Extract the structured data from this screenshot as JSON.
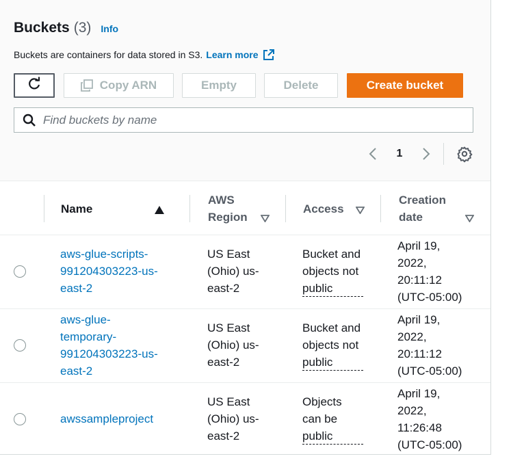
{
  "header": {
    "title": "Buckets",
    "count": "(3)",
    "info": "Info",
    "description": "Buckets are containers for data stored in S3.",
    "learn_more": "Learn more"
  },
  "toolbar": {
    "copy_arn": "Copy ARN",
    "empty": "Empty",
    "delete": "Delete",
    "create": "Create bucket"
  },
  "search": {
    "placeholder": "Find buckets by name"
  },
  "pagination": {
    "page": "1"
  },
  "table": {
    "columns": {
      "name": "Name",
      "region_line1": "AWS",
      "region_line2": "Region",
      "access": "Access",
      "date_line1": "Creation",
      "date_line2": "date"
    },
    "rows": [
      {
        "name": [
          "aws-glue-scripts-",
          "991204303223-us-",
          "east-2"
        ],
        "region": [
          "US East",
          "(Ohio) us-",
          "east-2"
        ],
        "access": [
          "Bucket and",
          "objects not",
          "public"
        ],
        "date": [
          "April 19,",
          "2022,",
          "20:11:12",
          "(UTC-05:00)"
        ]
      },
      {
        "name": [
          "aws-glue-",
          "temporary-",
          "991204303223-us-",
          "east-2"
        ],
        "region": [
          "US East",
          "(Ohio) us-",
          "east-2"
        ],
        "access": [
          "Bucket and",
          "objects not",
          "public"
        ],
        "date": [
          "April 19,",
          "2022,",
          "20:11:12",
          "(UTC-05:00)"
        ]
      },
      {
        "name": [
          "awssampleproject"
        ],
        "region": [
          "US East",
          "(Ohio) us-",
          "east-2"
        ],
        "access": [
          "Objects",
          "can be",
          "public"
        ],
        "date": [
          "April 19,",
          "2022,",
          "11:26:48",
          "(UTC-05:00)"
        ]
      }
    ]
  },
  "colors": {
    "link": "#0073bb",
    "primary_button": "#ec7211",
    "disabled_text": "#aab7b8",
    "heading_text": "#16191f"
  },
  "icons": [
    "refresh-icon",
    "copy-icon",
    "external-link-icon",
    "search-icon",
    "chevron-left-icon",
    "chevron-right-icon",
    "gear-icon",
    "sort-ascending-icon",
    "sort-descending-icon"
  ]
}
